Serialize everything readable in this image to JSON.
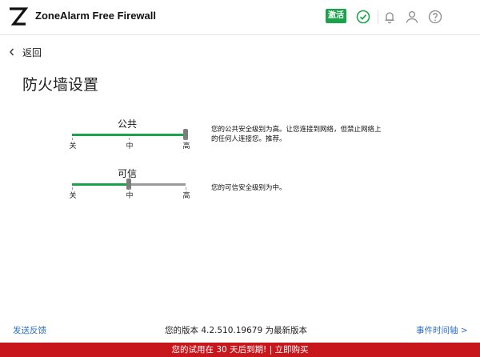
{
  "header": {
    "app_title": "ZoneAlarm Free Firewall",
    "activate_label": "激活",
    "icons": [
      "zonealarm-logo",
      "check-circle-icon",
      "bell-icon",
      "user-icon",
      "help-icon"
    ],
    "colors": {
      "accent_green": "#1aa34a",
      "icon_gray": "#8a8a8a"
    }
  },
  "nav": {
    "back_label": "返回"
  },
  "page": {
    "title": "防火墙设置"
  },
  "sliders": [
    {
      "name": "公共",
      "level": "高",
      "level_fraction": 1.0,
      "ticks": [
        "关",
        "中",
        "高"
      ],
      "description": "您的公共安全级别为高。让您连接到网络，但禁止网络上的任何人连接您。推荐。"
    },
    {
      "name": "可信",
      "level": "中",
      "level_fraction": 0.5,
      "ticks": [
        "关",
        "中",
        "高"
      ],
      "description": "您的可信安全级别为中。"
    }
  ],
  "footer": {
    "feedback_link": "发送反馈",
    "version_text": "您的版本 4.2.510.19679 为最新版本",
    "timeline_link": "事件时间轴 >"
  },
  "trial": {
    "message": "您的试用在 30 天后到期! | 立即购买",
    "bar_color": "#c8161d"
  }
}
